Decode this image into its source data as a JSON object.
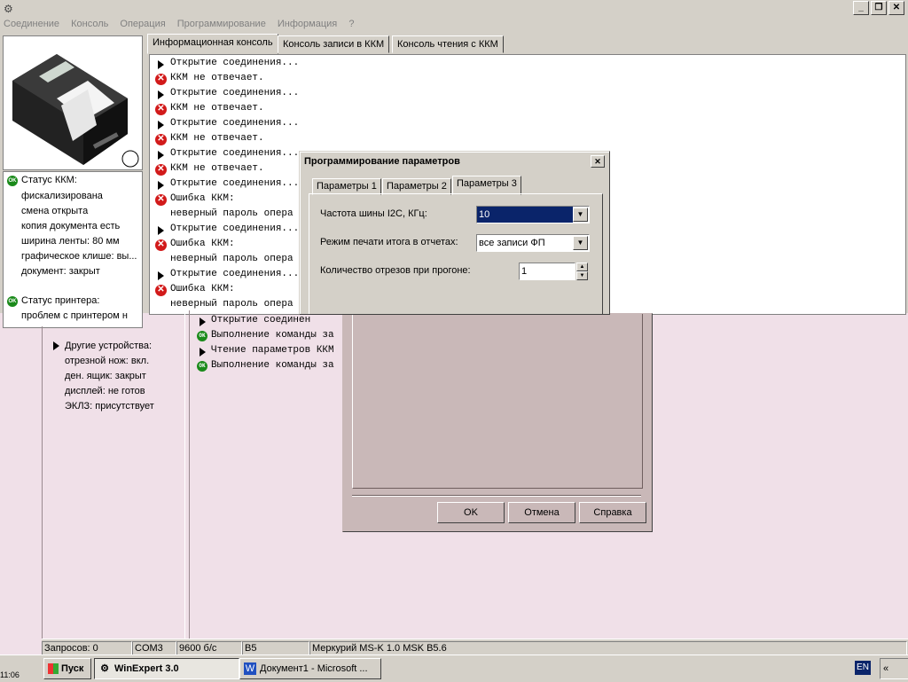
{
  "window": {
    "menu": [
      "Соединение",
      "Консоль",
      "Операция",
      "Программирование",
      "Информация",
      "?"
    ],
    "controls": {
      "minimize": "_",
      "maximize": "❐",
      "close": "✕"
    }
  },
  "status_panel": {
    "kkm_header": "Статус ККМ:",
    "kkm_items": [
      "фискализирована",
      "смена открыта",
      "копия документа есть",
      "ширина ленты: 80 мм",
      "графическое клише: вы...",
      "документ: закрыт"
    ],
    "printer_header": "Статус принтера:",
    "printer_items": [
      "проблем с принтером н"
    ],
    "other_header": "Другие устройства:",
    "other_items": [
      "отрезной нож: вкл.",
      "ден. ящик: закрыт",
      "дисплей: не готов",
      "ЭКЛЗ: присутствует"
    ]
  },
  "tabs": [
    "Информационная консоль",
    "Консоль записи в ККМ",
    "Консоль чтения с ККМ"
  ],
  "console_lines": [
    {
      "icon": "arrow",
      "text": "Открытие соединения..."
    },
    {
      "icon": "error",
      "text": "ККМ не отвечает."
    },
    {
      "icon": "arrow",
      "text": "Открытие соединения..."
    },
    {
      "icon": "error",
      "text": "ККМ не отвечает."
    },
    {
      "icon": "arrow",
      "text": "Открытие соединения..."
    },
    {
      "icon": "error",
      "text": "ККМ не отвечает."
    },
    {
      "icon": "arrow",
      "text": "Открытие соединения..."
    },
    {
      "icon": "error",
      "text": "ККМ не отвечает."
    },
    {
      "icon": "arrow",
      "text": "Открытие соединения..."
    },
    {
      "icon": "error",
      "text": "Ошибка ККМ:"
    },
    {
      "icon": "none",
      "text": "неверный пароль опера"
    },
    {
      "icon": "arrow",
      "text": "Открытие соединения..."
    },
    {
      "icon": "error",
      "text": "Ошибка ККМ:"
    },
    {
      "icon": "none",
      "text": "неверный пароль опера"
    },
    {
      "icon": "arrow",
      "text": "Открытие соединения..."
    },
    {
      "icon": "error",
      "text": "Ошибка ККМ:"
    },
    {
      "icon": "none",
      "text": "неверный пароль опера"
    }
  ],
  "ghost_console": [
    {
      "icon": "arrow",
      "text": "Открытие соединен"
    },
    {
      "icon": "ok",
      "text": "Выполнение команды за"
    },
    {
      "icon": "arrow",
      "text": "Чтение параметров ККМ"
    },
    {
      "icon": "ok",
      "text": "Выполнение команды за"
    }
  ],
  "dialog": {
    "title": "Программирование параметров",
    "close": "✕",
    "tabs": [
      "Параметры 1",
      "Параметры 2",
      "Параметры 3"
    ],
    "fields": {
      "i2c_label": "Частота шины I2C, КГц:",
      "i2c_value": "10",
      "print_mode_label": "Режим печати итога в отчетах:",
      "print_mode_value": "все записи ФП",
      "cuts_label": "Количество отрезов при прогоне:",
      "cuts_value": "1"
    },
    "buttons": {
      "ok": "OK",
      "cancel": "Отмена",
      "help": "Справка"
    }
  },
  "statusbar": {
    "requests": "Запросов: 0",
    "port": "COM3",
    "baud": "9600 б/с",
    "code": "B5",
    "device": "Меркурий MS-K 1.0 MSK B5.6"
  },
  "taskbar": {
    "start": "Пуск",
    "tasks": [
      "WinExpert 3.0",
      "Документ1 - Microsoft ..."
    ],
    "lang": "EN",
    "tray": "«",
    "clock": "11:06"
  }
}
